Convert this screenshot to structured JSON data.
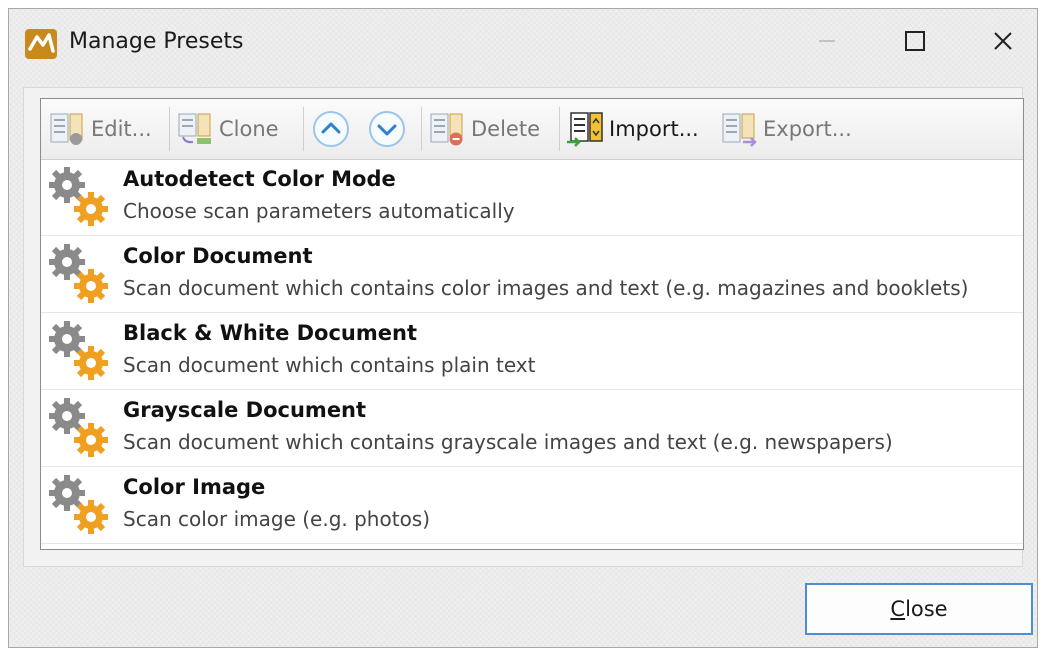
{
  "window": {
    "title": "Manage Presets",
    "icon": "app-logo-icon",
    "controls": {
      "minimize": "minimize-icon",
      "maximize": "maximize-icon",
      "close": "close-icon"
    }
  },
  "toolbar": {
    "edit_label": "Edit...",
    "clone_label": "Clone",
    "move_up_icon": "arrow-up-circle-icon",
    "move_down_icon": "arrow-down-circle-icon",
    "delete_label": "Delete",
    "import_label": "Import...",
    "export_label": "Export..."
  },
  "presets": [
    {
      "name": "Autodetect Color Mode",
      "description": "Choose scan parameters automatically"
    },
    {
      "name": "Color Document",
      "description": "Scan document which contains color images and text (e.g. magazines and booklets)"
    },
    {
      "name": "Black & White Document",
      "description": "Scan document which contains plain text"
    },
    {
      "name": "Grayscale Document",
      "description": "Scan document which contains grayscale images and text (e.g. newspapers)"
    },
    {
      "name": "Color Image",
      "description": "Scan color image (e.g. photos)"
    }
  ],
  "footer": {
    "close_label_prefix": "",
    "close_label_mnemonic": "C",
    "close_label_rest": "lose"
  },
  "colors": {
    "accent_blue": "#4a90d9",
    "gear_orange": "#f0a020",
    "gear_gray": "#8a8a8a"
  }
}
